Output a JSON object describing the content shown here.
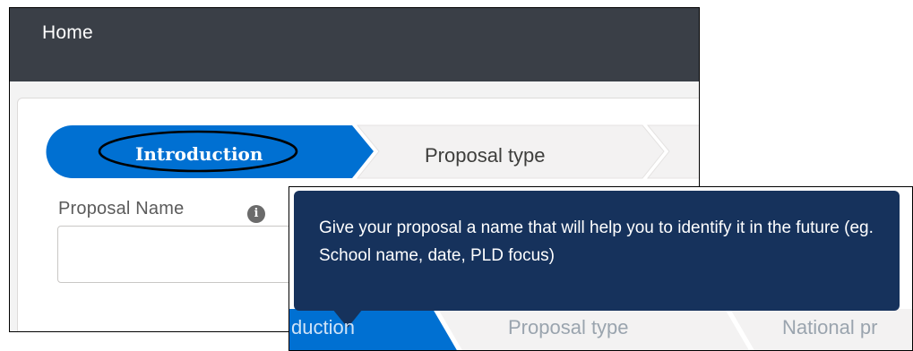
{
  "header": {
    "title": "Home"
  },
  "path": {
    "steps": [
      {
        "label": "Introduction",
        "state": "current"
      },
      {
        "label": "Proposal type",
        "state": "upcoming"
      }
    ],
    "colors": {
      "current": "#0070d2",
      "upcoming": "#f3f2f2",
      "highlight_outline": "#000000"
    }
  },
  "form": {
    "proposal_name_label": "Proposal Name",
    "proposal_name_value": "",
    "info_icon": "info-icon"
  },
  "tooltip": {
    "text": "Give your proposal a name that will help you to identify it in the future (eg. School name, date, PLD focus)",
    "background": "#16325c"
  },
  "zoom_background": {
    "ghost_labels": [
      "duction",
      "Proposal type",
      "National pr"
    ]
  }
}
